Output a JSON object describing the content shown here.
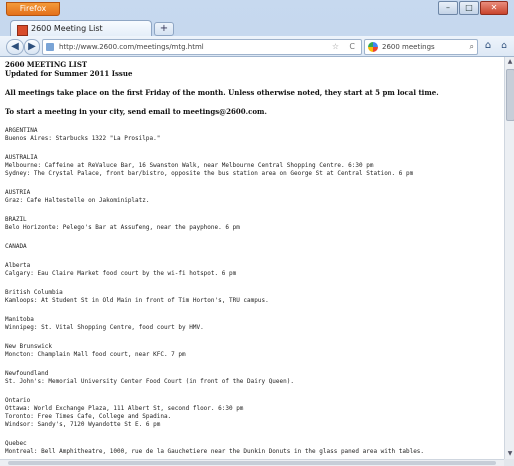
{
  "window": {
    "app_button": "Firefox",
    "controls": {
      "minimize": "–",
      "maximize": "□",
      "close": "✕"
    }
  },
  "tab": {
    "title": "2600 Meeting List",
    "new_tab": "+"
  },
  "nav": {
    "back": "◀",
    "forward": "▶",
    "url": "http://www.2600.com/meetings/mtg.html",
    "bookmark": "☆",
    "reload": "C",
    "search_text": "2600 meetings",
    "search_icon": "search-icon",
    "home": "⌂",
    "extension": "⌂"
  },
  "page": {
    "title": "2600 MEETING LIST",
    "subtitle": "Updated for Summer 2011 Issue",
    "info": "All meetings take place on the first Friday of the month. Unless otherwise noted, they start at 5 pm local time.",
    "contact": "To start a meeting in your city, send email to meetings@2600.com.",
    "regions": [
      {
        "name": "ARGENTINA",
        "lines": [
          "Buenos Aires: Starbucks 1322 \"La Prosilpa.\""
        ]
      },
      {
        "name": "AUSTRALIA",
        "lines": [
          "Melbourne: Caffeine at ReValuce Bar, 16 Swanston Walk, near Melbourne Central Shopping Centre. 6:30 pm",
          "Sydney: The Crystal Palace, front bar/bistro, opposite the bus station area on George St at Central Station. 6 pm"
        ]
      },
      {
        "name": "AUSTRIA",
        "lines": [
          "Graz: Cafe Haltestelle on Jakominiplatz."
        ]
      },
      {
        "name": "BRAZIL",
        "lines": [
          "Belo Horizonte: Pelego's Bar at Assufeng, near the payphone. 6 pm"
        ]
      },
      {
        "name": "CANADA",
        "lines": []
      },
      {
        "name": "Alberta",
        "lines": [
          "Calgary: Eau Claire Market food court by the wi-fi hotspot. 6 pm"
        ]
      },
      {
        "name": "British Columbia",
        "lines": [
          "Kamloops: At Student St in Old Main in front of Tim Horton's, TRU campus."
        ]
      },
      {
        "name": "Manitoba",
        "lines": [
          "Winnipeg: St. Vital Shopping Centre, food court by HMV."
        ]
      },
      {
        "name": "New Brunswick",
        "lines": [
          "Moncton: Champlain Mall food court, near KFC. 7 pm"
        ]
      },
      {
        "name": "Newfoundland",
        "lines": [
          "St. John's: Memorial University Center Food Court (in front of the Dairy Queen)."
        ]
      },
      {
        "name": "Ontario",
        "lines": [
          "Ottawa: World Exchange Plaza, 111 Albert St, second floor. 6:30 pm",
          "Toronto: Free Times Cafe, College and Spadina.",
          "Windsor: Sandy's, 7120 Wyandotte St E. 6 pm"
        ]
      },
      {
        "name": "Quebec",
        "lines": [
          "Montreal: Bell Amphitheatre, 1000, rue de la Gauchetiere near the Dunkin Donuts in the glass paned area with tables."
        ]
      }
    ]
  }
}
